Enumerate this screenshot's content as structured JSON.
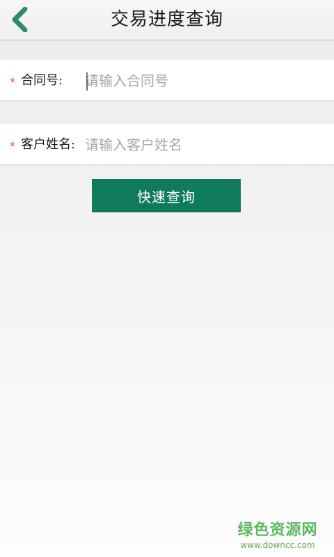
{
  "header": {
    "title": "交易进度查询",
    "back_icon": "chevron-left-icon",
    "accent": "#2e8b6f"
  },
  "form": {
    "contract": {
      "required_mark": "*",
      "label": "合同号:",
      "placeholder": "请输入合同号",
      "value": ""
    },
    "customer": {
      "required_mark": "*",
      "label": "客户姓名:",
      "placeholder": "请输入客户姓名",
      "value": ""
    }
  },
  "query_button": {
    "label": "快速查询",
    "color": "#0f7a5c"
  },
  "watermark": {
    "brand": "绿色资源网",
    "url": "www.downcc.com"
  }
}
